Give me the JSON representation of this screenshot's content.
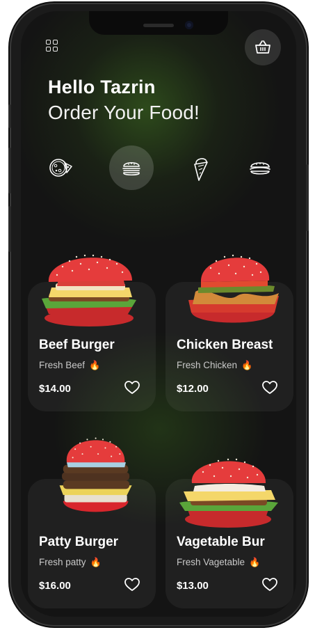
{
  "header": {
    "greeting": "Hello  Tazrin",
    "subtitle": "Order Your Food!"
  },
  "icons": {
    "menu": "grid-menu-icon",
    "cart": "basket-icon",
    "categories": [
      "pizza-icon",
      "burger-icon",
      "ice-cream-icon",
      "hotdog-icon"
    ]
  },
  "categories": {
    "active_index": 1
  },
  "products": [
    {
      "name": "Beef Burger",
      "description": "Fresh Beef",
      "price": "$14.00"
    },
    {
      "name": "Chicken Breast",
      "description": "Fresh Chicken",
      "price": "$12.00"
    },
    {
      "name": "Patty Burger",
      "description": "Fresh patty",
      "price": "$16.00"
    },
    {
      "name": "Vagetable Bur",
      "description": "Fresh Vagetable",
      "price": "$13.00"
    }
  ],
  "colors": {
    "background": "#141414",
    "accent_glow": "#30501c",
    "bun_red": "#e23a3a"
  }
}
